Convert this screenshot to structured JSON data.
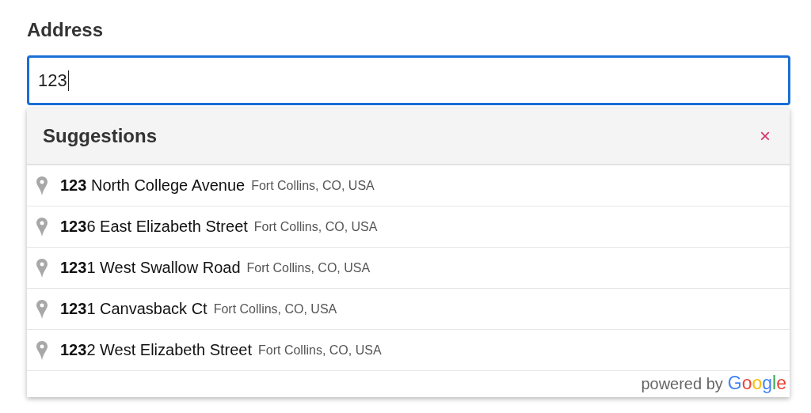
{
  "field": {
    "label": "Address",
    "value": "123",
    "focused": true
  },
  "suggestions": {
    "title": "Suggestions",
    "close": "×",
    "items": [
      {
        "main": "**123** North College Avenue",
        "secondary": "Fort Collins, CO, USA"
      },
      {
        "main": "**123**6 East Elizabeth Street",
        "secondary": "Fort Collins, CO, USA"
      },
      {
        "main": "**123**1 West Swallow Road",
        "secondary": "Fort Collins, CO, USA"
      },
      {
        "main": "**123**1 Canvasback Ct",
        "secondary": "Fort Collins, CO, USA"
      },
      {
        "main": "**123**2 West Elizabeth Street",
        "secondary": "Fort Collins, CO, USA"
      }
    ],
    "attribution": "powered by",
    "logo": "Google"
  }
}
